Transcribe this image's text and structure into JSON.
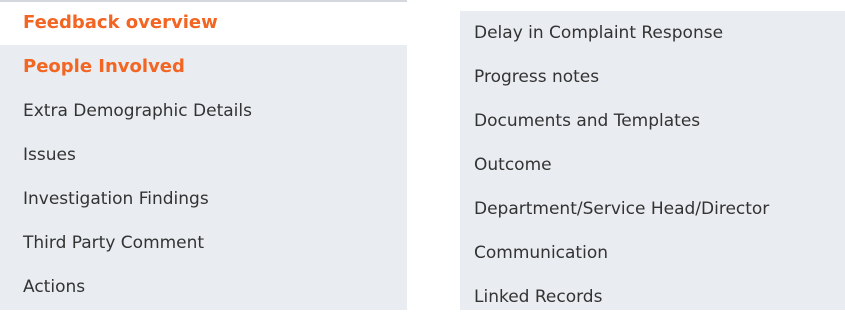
{
  "left_nav": {
    "items": [
      {
        "label": "Feedback overview",
        "state": "current"
      },
      {
        "label": "People Involved",
        "state": "highlight"
      },
      {
        "label": "Extra Demographic Details",
        "state": "normal"
      },
      {
        "label": "Issues",
        "state": "normal"
      },
      {
        "label": "Investigation Findings",
        "state": "normal"
      },
      {
        "label": "Third Party Comment",
        "state": "normal"
      },
      {
        "label": "Actions",
        "state": "normal"
      }
    ]
  },
  "right_nav": {
    "items": [
      {
        "label": "Delay in Complaint Response"
      },
      {
        "label": "Progress notes"
      },
      {
        "label": "Documents and Templates"
      },
      {
        "label": "Outcome"
      },
      {
        "label": "Department/Service Head/Director"
      },
      {
        "label": "Communication"
      },
      {
        "label": "Linked Records"
      }
    ]
  },
  "colors": {
    "accent": "#f26522",
    "panel_background": "#e9ecf0",
    "text": "#333333"
  }
}
